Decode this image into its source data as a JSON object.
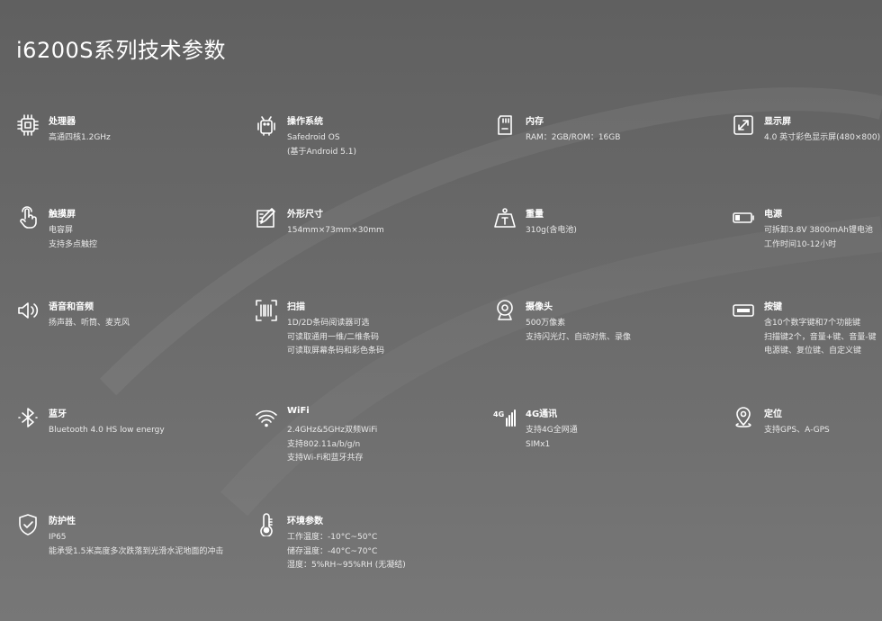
{
  "page": {
    "title": "i6200S系列技术参数"
  },
  "specs": [
    {
      "icon": "cpu-chip-icon",
      "label": "处理器",
      "lines": [
        "高通四核1.2GHz"
      ]
    },
    {
      "icon": "android-robot-icon",
      "label": "操作系统",
      "lines": [
        "Safedroid OS",
        "(基于Android 5.1)"
      ]
    },
    {
      "icon": "sd-card-icon",
      "label": "内存",
      "lines": [
        "RAM：2GB/ROM：16GB"
      ]
    },
    {
      "icon": "expand-diagonal-icon",
      "label": "显示屏",
      "lines": [
        "4.0 英寸彩色显示屏(480×800)"
      ]
    },
    {
      "icon": "touch-hand-icon",
      "label": "触摸屏",
      "lines": [
        "电容屏",
        "支持多点触控"
      ]
    },
    {
      "icon": "ruler-pencil-icon",
      "label": "外形尺寸",
      "lines": [
        "154mm×73mm×30mm"
      ]
    },
    {
      "icon": "weight-icon",
      "label": "重量",
      "lines": [
        "310g(含电池)"
      ]
    },
    {
      "icon": "battery-icon",
      "label": "电源",
      "lines": [
        "可拆卸3.8V 3800mAh锂电池",
        "工作时间10-12小时"
      ]
    },
    {
      "icon": "speaker-icon",
      "label": "语音和音频",
      "lines": [
        "扬声器、听筒、麦克风"
      ]
    },
    {
      "icon": "barcode-scan-icon",
      "label": "扫描",
      "lines": [
        "1D/2D条码阅读器可选",
        "可读取通用一维/二维条码",
        "可读取屏幕条码和彩色条码"
      ]
    },
    {
      "icon": "webcam-icon",
      "label": "摄像头",
      "lines": [
        "500万像素",
        "支持闪光灯、自动对焦、录像"
      ]
    },
    {
      "icon": "keyboard-key-icon",
      "label": "按键",
      "lines": [
        "含10个数字键和7个功能键",
        "扫描键2个，音量+键、音量-键",
        "电源键、复位键、自定义键"
      ]
    },
    {
      "icon": "bluetooth-icon",
      "label": "蓝牙",
      "lines": [
        "Bluetooth 4.0 HS low energy"
      ]
    },
    {
      "icon": "wifi-icon",
      "label": "WiFi",
      "lines": [
        "2.4GHz&5GHz双频WiFi",
        "支持802.11a/b/g/n",
        "支持Wi-Fi和蓝牙共存"
      ]
    },
    {
      "icon": "signal-4g-icon",
      "label": "4G通讯",
      "lines": [
        "支持4G全网通",
        "SIMx1"
      ]
    },
    {
      "icon": "location-pin-icon",
      "label": "定位",
      "lines": [
        "支持GPS、A-GPS"
      ]
    },
    {
      "icon": "shield-check-icon",
      "label": "防护性",
      "lines": [
        "IP65",
        "能承受1.5米高度多次跌落到光滑水泥地面的冲击"
      ]
    },
    {
      "icon": "thermometer-icon",
      "label": "环境参数",
      "lines": [
        "工作温度：-10°C~50°C",
        "储存温度：-40°C~70°C",
        "湿度：5%RH~95%RH (无凝结)"
      ]
    }
  ]
}
